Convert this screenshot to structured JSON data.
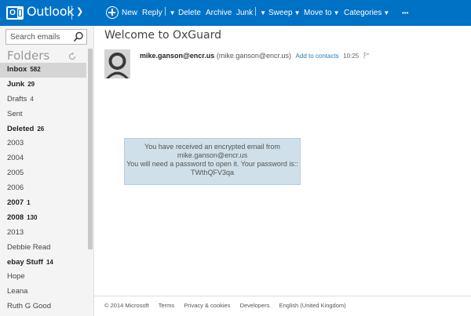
{
  "app": {
    "brand": "Outlook",
    "accent_color": "#0072c6"
  },
  "toolbar": {
    "new": "New",
    "reply": "Reply",
    "delete": "Delete",
    "archive": "Archive",
    "junk": "Junk",
    "sweep": "Sweep",
    "move_to": "Move to",
    "categories": "Categories",
    "more": "•••"
  },
  "search": {
    "placeholder": "Search emails"
  },
  "folders": {
    "header": "Folders",
    "items": [
      {
        "name": "Inbox",
        "count": "582",
        "bold": true,
        "selected": true
      },
      {
        "name": "Junk",
        "count": "29",
        "bold": true
      },
      {
        "name": "Drafts",
        "count": "4",
        "bold": false
      },
      {
        "name": "Sent",
        "count": "",
        "bold": false
      },
      {
        "name": "Deleted",
        "count": "26",
        "bold": true
      },
      {
        "name": "2003",
        "count": "",
        "bold": false
      },
      {
        "name": "2004",
        "count": "",
        "bold": false
      },
      {
        "name": "2005",
        "count": "",
        "bold": false
      },
      {
        "name": "2006",
        "count": "",
        "bold": false
      },
      {
        "name": "2007",
        "count": "1",
        "bold": true
      },
      {
        "name": "2008",
        "count": "130",
        "bold": true
      },
      {
        "name": "2013",
        "count": "",
        "bold": false
      },
      {
        "name": "Debbie Read",
        "count": "",
        "bold": false
      },
      {
        "name": "ebay Stuff",
        "count": "14",
        "bold": true
      },
      {
        "name": "Hope",
        "count": "",
        "bold": false
      },
      {
        "name": "Leana",
        "count": "",
        "bold": false
      },
      {
        "name": "Ruth G Good",
        "count": "",
        "bold": false
      }
    ]
  },
  "message": {
    "subject": "Welcome to OxGuard",
    "sender_name": "mike.ganson@encr.us",
    "sender_address": "(mike.ganson@encr.us)",
    "add_to_contacts": "Add to contacts",
    "time": "10:25",
    "body_lines": [
      "You have received an encrypted email from",
      "mike.ganson@encr.us",
      "You will need a password to open it. Your password is::",
      "TWthQFV3qa"
    ]
  },
  "footer": {
    "copyright": "© 2014 Microsoft",
    "terms": "Terms",
    "privacy": "Privacy & cookies",
    "developers": "Developers",
    "language": "English (United Kingdom)"
  }
}
